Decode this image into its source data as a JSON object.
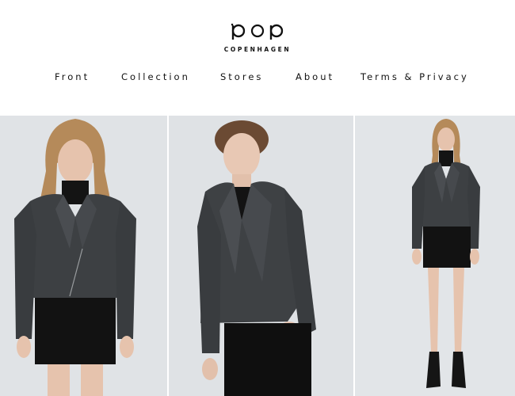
{
  "brand": {
    "name": "pop",
    "subtitle": "COPENHAGEN"
  },
  "nav": {
    "items": [
      {
        "label": "Front"
      },
      {
        "label": "Collection"
      },
      {
        "label": "Stores"
      },
      {
        "label": "About"
      },
      {
        "label": "Terms & Privacy"
      }
    ]
  },
  "colors": {
    "background": "#ffffff",
    "text": "#111111",
    "photo_backdrop": "#dfe2e5",
    "jacket": "#3d4043",
    "garment_black": "#111111",
    "skin": "#e6c3ad",
    "hair_blonde": "#b58a5a",
    "hair_brown": "#6b4a33"
  },
  "gallery": {
    "images": [
      {
        "subject": "woman in grey leather biker jacket and black mini skirt, close-up"
      },
      {
        "subject": "man in grey leather biker jacket and black jeans"
      },
      {
        "subject": "woman in grey leather biker jacket, full length, black ankle boots"
      }
    ]
  }
}
